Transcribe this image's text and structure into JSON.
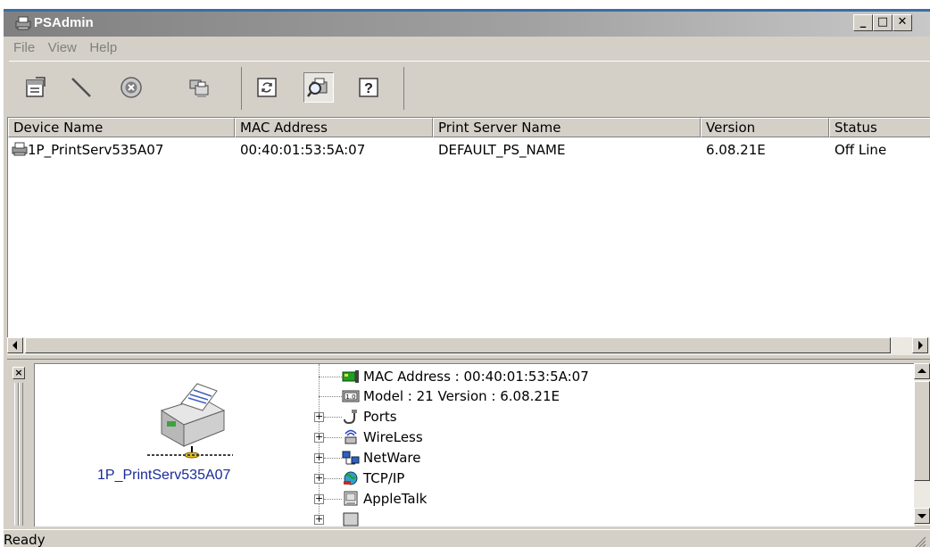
{
  "window": {
    "title": "PSAdmin"
  },
  "menu": [
    "File",
    "View",
    "Help"
  ],
  "toolbar": {
    "buttons": [
      "properties-icon",
      "wand-icon",
      "stop-icon",
      "printer-network-icon",
      "refresh-icon",
      "search-printer-icon",
      "help-icon"
    ]
  },
  "list": {
    "columns": [
      "Device Name",
      "MAC Address",
      "Print Server Name",
      "Version",
      "Status"
    ],
    "rows": [
      {
        "device": "1P_PrintServ535A07",
        "mac": "00:40:01:53:5A:07",
        "server": "DEFAULT_PS_NAME",
        "version": "6.08.21E",
        "status": "Off Line"
      }
    ]
  },
  "detail": {
    "device_label": "1P_PrintServ535A07",
    "tree": {
      "mac": "MAC Address : 00:40:01:53:5A:07",
      "model": "Model : 21   Version : 6.08.21E",
      "ports": "Ports",
      "wireless": "WireLess",
      "netware": "NetWare",
      "tcpip": "TCP/IP",
      "appletalk": "AppleTalk"
    }
  },
  "status": {
    "text": "Ready"
  },
  "colors": {
    "device_label": "#1a2a9a",
    "title_bar": "#808080"
  }
}
